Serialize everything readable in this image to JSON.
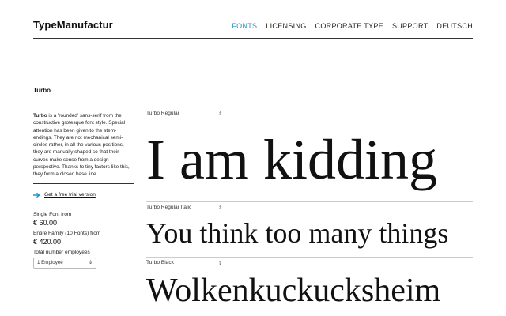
{
  "header": {
    "logo": "TypeManufactur",
    "nav": [
      {
        "label": "FONTS",
        "active": true
      },
      {
        "label": "LICENSING"
      },
      {
        "label": "CORPORATE TYPE"
      },
      {
        "label": "SUPPORT"
      },
      {
        "label": "DEUTSCH"
      }
    ]
  },
  "sidebar": {
    "title": "Turbo",
    "desc_bold": "Turbo",
    "desc_rest": " is a 'rounded' sans-serif from the constructive grotesque font style. Special attention has been given to the stem-endings. They are not mechanical semi-circles rather, in all the various positions, they are manually shaped so that their curves make sense from a design perspective. Thanks to tiny factors like this, they form a closed base line.",
    "trial_link": "Get a free trial version",
    "single_label": "Single Font from",
    "single_price": "€ 60.00",
    "family_label": "Entire Family (10 Fonts) from",
    "family_price": "€ 420.00",
    "employees_label": "Total number employees",
    "employees_value": "1 Employee"
  },
  "samples": [
    {
      "style": "Turbo Regular",
      "text": "I am kidding"
    },
    {
      "style": "Turbo Regular Italic",
      "text": "You think too many things"
    },
    {
      "style": "Turbo Black",
      "text": "Wolkenkuckucksheim"
    }
  ],
  "colors": {
    "accent": "#1a96c8",
    "text": "#111111",
    "rule": "#333333"
  }
}
